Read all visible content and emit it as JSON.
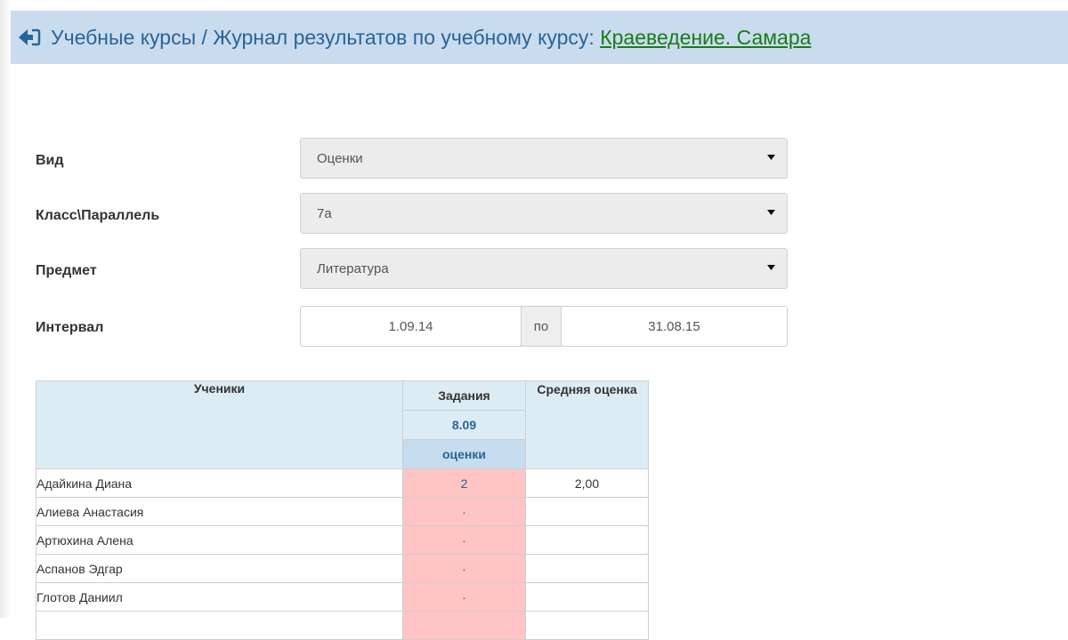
{
  "header": {
    "back_icon": "back-arrow-icon",
    "breadcrumb": "Учебные курсы / Журнал результатов по учебному курсу: ",
    "course_link": "Краеведение. Самара"
  },
  "form": {
    "view": {
      "label": "Вид",
      "value": "Оценки"
    },
    "class": {
      "label": "Класс\\Параллель",
      "value": "7а"
    },
    "subject": {
      "label": "Предмет",
      "value": "Литература"
    },
    "interval": {
      "label": "Интервал",
      "from": "1.09.14",
      "separator": "по",
      "to": "31.08.15"
    }
  },
  "table": {
    "col_students": "Ученики",
    "col_tasks": "Задания",
    "task_date": "8.09",
    "task_kind": "оценки",
    "col_average": "Средняя оценка",
    "rows": [
      {
        "name": "Адайкина Диана",
        "grade": "2",
        "average": "2,00"
      },
      {
        "name": "Алиева Анастасия",
        "grade": "·",
        "average": ""
      },
      {
        "name": "Артюхина Алена",
        "grade": "·",
        "average": ""
      },
      {
        "name": "Аспанов Эдгар",
        "grade": "·",
        "average": ""
      },
      {
        "name": "Глотов Даниил",
        "grade": "·",
        "average": ""
      },
      {
        "name": "",
        "grade": "",
        "average": ""
      }
    ]
  },
  "colors": {
    "header_bg": "#c9dcee",
    "link_green": "#1a7a1a",
    "title_blue": "#2a6496",
    "grade_cell_bg": "#ffc4c4"
  }
}
